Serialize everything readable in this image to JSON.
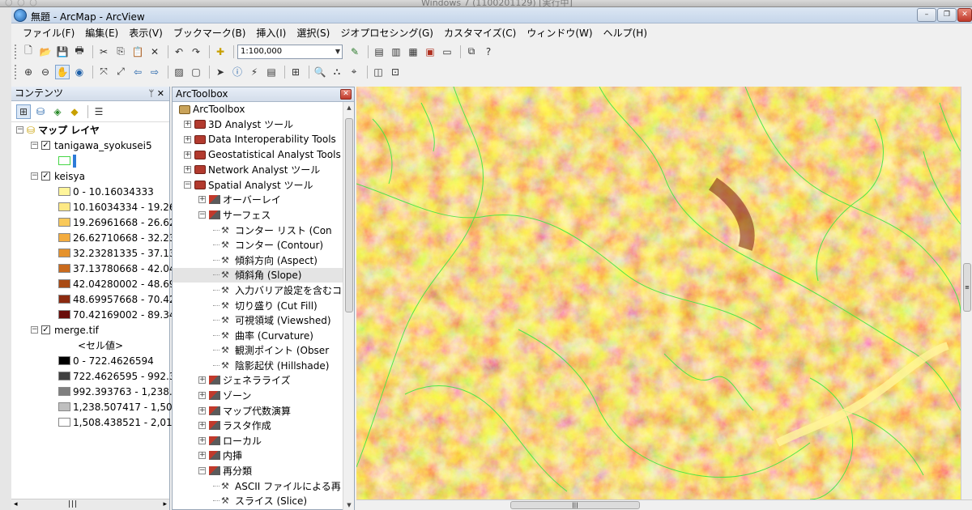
{
  "vm": {
    "title": "Windows 7 (1100201129) [実行中]"
  },
  "window": {
    "title": "無題 - ArcMap - ArcView",
    "min": "–",
    "max": "❐",
    "close": "✕"
  },
  "menu": [
    "ファイル(F)",
    "編集(E)",
    "表示(V)",
    "ブックマーク(B)",
    "挿入(I)",
    "選択(S)",
    "ジオプロセシング(G)",
    "カスタマイズ(C)",
    "ウィンドウ(W)",
    "ヘルプ(H)"
  ],
  "toolbar": {
    "scale_value": "1:100,000"
  },
  "toc": {
    "title": "コンテンツ",
    "pin": "ᛘ ✕",
    "root": "マップ レイヤ",
    "layers": [
      {
        "name": "tanigawa_syokusei5"
      },
      {
        "name": "keisya",
        "classes": [
          {
            "label": "0 - 10.16034333",
            "color": "#fff59a"
          },
          {
            "label": "10.16034334 - 19.26",
            "color": "#fde884"
          },
          {
            "label": "19.26961668 - 26.62",
            "color": "#f9c95a"
          },
          {
            "label": "26.62710668 - 32.23",
            "color": "#f3ac3f"
          },
          {
            "label": "32.23281335 - 37.13",
            "color": "#e5922c"
          },
          {
            "label": "37.13780668 - 42.04",
            "color": "#c96a1d"
          },
          {
            "label": "42.04280002 - 48.69",
            "color": "#a94a14"
          },
          {
            "label": "48.69957668 - 70.42",
            "color": "#8b2a10"
          },
          {
            "label": "70.42169002 - 89.34",
            "color": "#6a0d0a"
          }
        ]
      },
      {
        "name": "merge.tif",
        "subtitle": "<セル値>",
        "classes": [
          {
            "label": "0 - 722.4626594",
            "color": "#000000"
          },
          {
            "label": "722.4626595 - 992.3",
            "color": "#3f3f3f"
          },
          {
            "label": "992.393763 - 1,238.5",
            "color": "#7f7f7f"
          },
          {
            "label": "1,238.507417 - 1,508",
            "color": "#bfbfbf"
          },
          {
            "label": "1,508.438521 - 2,01",
            "color": "#ffffff"
          }
        ]
      }
    ]
  },
  "toolbox": {
    "title": "ArcToolbox",
    "root": "ArcToolbox",
    "items": [
      {
        "label": "3D Analyst ツール",
        "kind": "box",
        "level": 1
      },
      {
        "label": "Data Interoperability Tools",
        "kind": "box",
        "level": 1
      },
      {
        "label": "Geostatistical Analyst Tools",
        "kind": "box",
        "level": 1
      },
      {
        "label": "Network Analyst ツール",
        "kind": "box",
        "level": 1
      },
      {
        "label": "Spatial Analyst ツール",
        "kind": "box",
        "level": 1,
        "open": true
      },
      {
        "label": "オーバーレイ",
        "kind": "set",
        "level": 2
      },
      {
        "label": "サーフェス",
        "kind": "set",
        "level": 2,
        "open": true
      },
      {
        "label": "コンター リスト (Con",
        "kind": "tool",
        "level": 3
      },
      {
        "label": "コンター (Contour)",
        "kind": "tool",
        "level": 3
      },
      {
        "label": "傾斜方向 (Aspect)",
        "kind": "tool",
        "level": 3
      },
      {
        "label": "傾斜角 (Slope)",
        "kind": "tool",
        "level": 3,
        "selected": true
      },
      {
        "label": "入力バリア設定を含むコ",
        "kind": "tool",
        "level": 3
      },
      {
        "label": "切り盛り (Cut Fill)",
        "kind": "tool",
        "level": 3
      },
      {
        "label": "可視領域 (Viewshed)",
        "kind": "tool",
        "level": 3
      },
      {
        "label": "曲率 (Curvature)",
        "kind": "tool",
        "level": 3
      },
      {
        "label": "観測ポイント (Obser",
        "kind": "tool",
        "level": 3
      },
      {
        "label": "陰影起伏 (Hillshade)",
        "kind": "tool",
        "level": 3
      },
      {
        "label": "ジェネラライズ",
        "kind": "set",
        "level": 2
      },
      {
        "label": "ゾーン",
        "kind": "set",
        "level": 2
      },
      {
        "label": "マップ代数演算",
        "kind": "set",
        "level": 2
      },
      {
        "label": "ラスタ作成",
        "kind": "set",
        "level": 2
      },
      {
        "label": "ローカル",
        "kind": "set",
        "level": 2
      },
      {
        "label": "内挿",
        "kind": "set",
        "level": 2
      },
      {
        "label": "再分類",
        "kind": "set",
        "level": 2,
        "open": true
      },
      {
        "label": "ASCII ファイルによる再",
        "kind": "tool",
        "level": 3
      },
      {
        "label": "スライス (Slice)",
        "kind": "tool",
        "level": 3
      }
    ]
  },
  "icons": {
    "new": "🗋",
    "open": "📂",
    "save": "💾",
    "print": "🖶",
    "cut": "✂",
    "copy": "⎘",
    "paste": "📋",
    "delete": "✕",
    "undo": "↶",
    "redo": "↷",
    "add-data": "✚",
    "zoom-in": "⊕",
    "zoom-out": "⊖",
    "pan": "✋",
    "globe": "◉",
    "back": "⇦",
    "forward": "⇨",
    "select": "➤",
    "identify": "ⓘ",
    "find": "🔍",
    "help": "?"
  }
}
